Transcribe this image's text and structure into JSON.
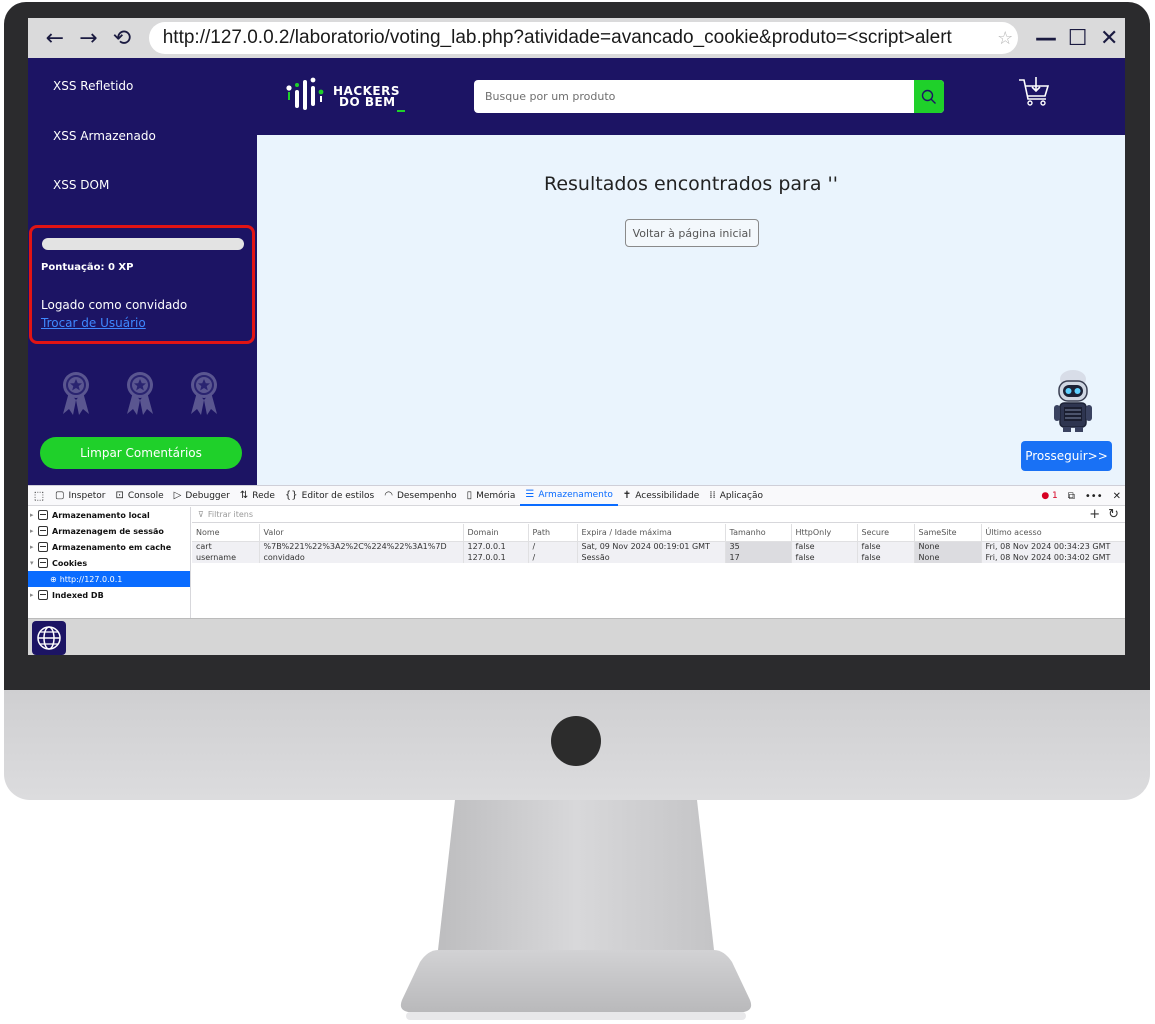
{
  "browser": {
    "url": "http://127.0.0.2/laboratorio/voting_lab.php?atividade=avancado_cookie&produto=<script>alert",
    "back_glyph": "←",
    "forward_glyph": "→",
    "reload_glyph": "⟲",
    "star_glyph": "☆",
    "minimize_glyph": "—",
    "maximize_glyph": "☐",
    "close_glyph": "✕"
  },
  "sidebar": {
    "items": [
      {
        "label": "XSS Refletido"
      },
      {
        "label": "XSS Armazenado"
      },
      {
        "label": "XSS DOM"
      }
    ],
    "score_label": "Pontuação: 0 XP",
    "score_progress": 0,
    "logged_label": "Logado como convidado",
    "switch_user_label": "Trocar de Usuário",
    "clear_comments_label": "Limpar Comentários"
  },
  "header": {
    "logo_line1": "HACKERS",
    "logo_line2": "DO BEM",
    "search_placeholder": "Busque por um produto"
  },
  "main": {
    "results_title": "Resultados encontrados para ''",
    "back_home_label": "Voltar à página inicial",
    "next_label": "Prosseguir>>"
  },
  "devtools": {
    "tabs": [
      {
        "icon": "▢",
        "label": "Inspetor"
      },
      {
        "icon": "⊡",
        "label": "Console"
      },
      {
        "icon": "▷",
        "label": "Debugger"
      },
      {
        "icon": "⇅",
        "label": "Rede"
      },
      {
        "icon": "{}",
        "label": "Editor de estilos"
      },
      {
        "icon": "◠",
        "label": "Desempenho"
      },
      {
        "icon": "▯",
        "label": "Memória"
      },
      {
        "icon": "☰",
        "label": "Armazenamento"
      },
      {
        "icon": "✝",
        "label": "Acessibilidade"
      },
      {
        "icon": "⁞⁞",
        "label": "Aplicação"
      }
    ],
    "error_count": "1",
    "tree": [
      {
        "label": "Armazenamento local"
      },
      {
        "label": "Armazenagem de sessão"
      },
      {
        "label": "Armazenamento em cache"
      },
      {
        "label": "Cookies"
      },
      {
        "label": "http://127.0.0.1"
      },
      {
        "label": "Indexed DB"
      }
    ],
    "filter_placeholder": "Filtrar itens",
    "columns": [
      "Nome",
      "Valor",
      "Domain",
      "Path",
      "Expira / Idade máxima",
      "Tamanho",
      "HttpOnly",
      "Secure",
      "SameSite",
      "Último acesso"
    ],
    "rows": [
      [
        "cart",
        "%7B%221%22%3A2%2C%224%22%3A1%7D",
        "127.0.0.1",
        "/",
        "Sat, 09 Nov 2024 00:19:01 GMT",
        "35",
        "false",
        "false",
        "None",
        "Fri, 08 Nov 2024 00:34:23 GMT"
      ],
      [
        "username",
        "convidado",
        "127.0.0.1",
        "/",
        "Sessão",
        "17",
        "false",
        "false",
        "None",
        "Fri, 08 Nov 2024 00:34:02 GMT"
      ]
    ]
  },
  "colors": {
    "brand_navy": "#1c1464",
    "accent_green": "#1fd02a",
    "primary_blue": "#1971f5",
    "highlight_red": "#e11414"
  }
}
